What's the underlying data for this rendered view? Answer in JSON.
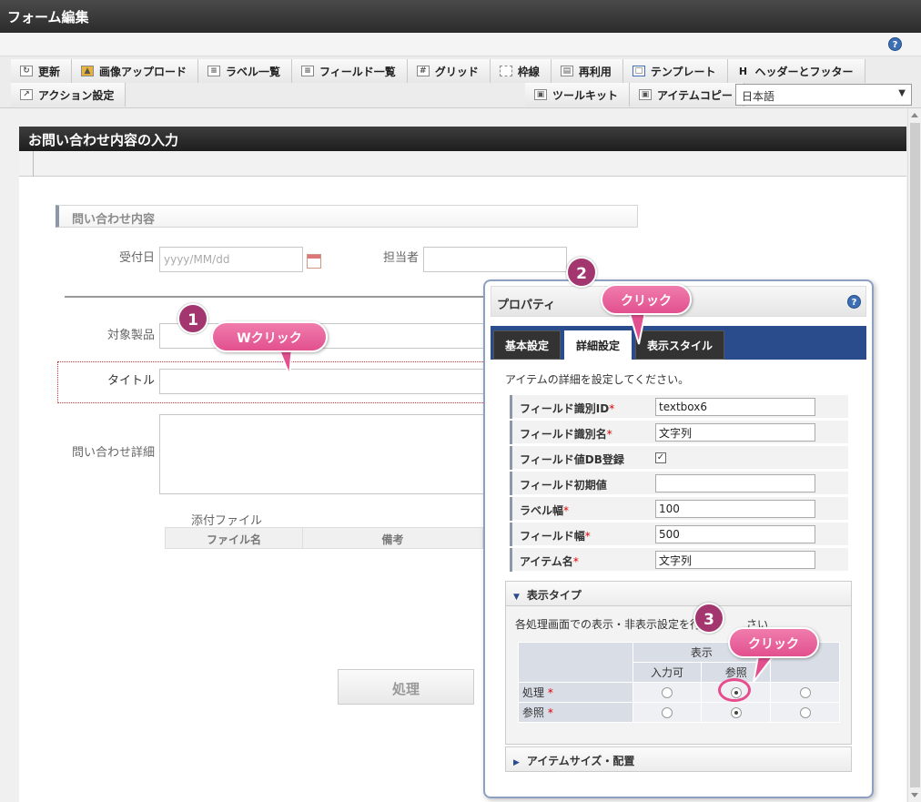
{
  "window": {
    "title": "フォーム編集",
    "help": "?"
  },
  "toolbar": {
    "row1": [
      {
        "label": "更新",
        "icon": "refresh-icon"
      },
      {
        "label": "画像アップロード",
        "icon": "image-upload-icon"
      },
      {
        "label": "ラベル一覧",
        "icon": "label-list-icon"
      },
      {
        "label": "フィールド一覧",
        "icon": "field-list-icon"
      },
      {
        "label": "グリッド",
        "icon": "grid-icon"
      },
      {
        "label": "枠線",
        "icon": "border-icon"
      },
      {
        "label": "再利用",
        "icon": "reuse-icon"
      },
      {
        "label": "テンプレート",
        "icon": "template-icon"
      },
      {
        "label": "ヘッダーとフッター",
        "icon": "header-footer-icon",
        "glyph": "H"
      }
    ],
    "action": {
      "label": "アクション設定",
      "icon": "action-icon"
    },
    "toolkit": {
      "label": "ツールキット",
      "icon": "toolkit-icon"
    },
    "item_copy": {
      "label": "アイテムコピー",
      "icon": "item-copy-icon"
    },
    "language": "日本語"
  },
  "form": {
    "title": "お問い合わせ内容の入力",
    "section": "問い合わせ内容",
    "fields": {
      "received_date_label": "受付日",
      "received_date_placeholder": "yyyy/MM/dd",
      "assignee_label": "担当者",
      "product_label": "対象製品",
      "title_label": "タイトル",
      "detail_label": "問い合わせ詳細",
      "attachment_label": "添付ファイル",
      "attachment_columns": [
        "ファイル名",
        "備考"
      ]
    },
    "process_button": "処理"
  },
  "properties": {
    "title": "プロパティ",
    "help": "?",
    "tabs": [
      "基本設定",
      "詳細設定",
      "表示スタイル"
    ],
    "active_tab": "詳細設定",
    "description": "アイテムの詳細を設定してください。",
    "rows": [
      {
        "key": "フィールド識別ID",
        "required": "*",
        "value": "textbox6"
      },
      {
        "key": "フィールド識別名",
        "required": "*",
        "value": "文字列"
      },
      {
        "key": "フィールド値DB登録",
        "required": "",
        "checked": "✓"
      },
      {
        "key": "フィールド初期値",
        "required": "",
        "value": ""
      },
      {
        "key": "ラベル幅",
        "required": "*",
        "value": "100"
      },
      {
        "key": "フィールド幅",
        "required": "*",
        "value": "500"
      },
      {
        "key": "アイテム名",
        "required": "*",
        "value": "文字列"
      }
    ],
    "display_type": {
      "title": "表示タイプ",
      "description": "各処理画面での表示・非表示設定を行",
      "description_tail": "さい",
      "group_header": "表示",
      "columns": [
        "入力可",
        "参照"
      ],
      "rows": [
        {
          "label": "処理",
          "required": "*",
          "selected": "参照"
        },
        {
          "label": "参照",
          "required": "*",
          "selected": "参照"
        }
      ]
    },
    "size_section": "アイテムサイズ・配置"
  },
  "callouts": [
    {
      "num": "1",
      "text": "Wクリック"
    },
    {
      "num": "2",
      "text": "クリック"
    },
    {
      "num": "3",
      "text": "クリック"
    }
  ],
  "colors": {
    "accent": "#2b4c8c",
    "callout": "#e2508f",
    "callout_num": "#a3356f"
  }
}
